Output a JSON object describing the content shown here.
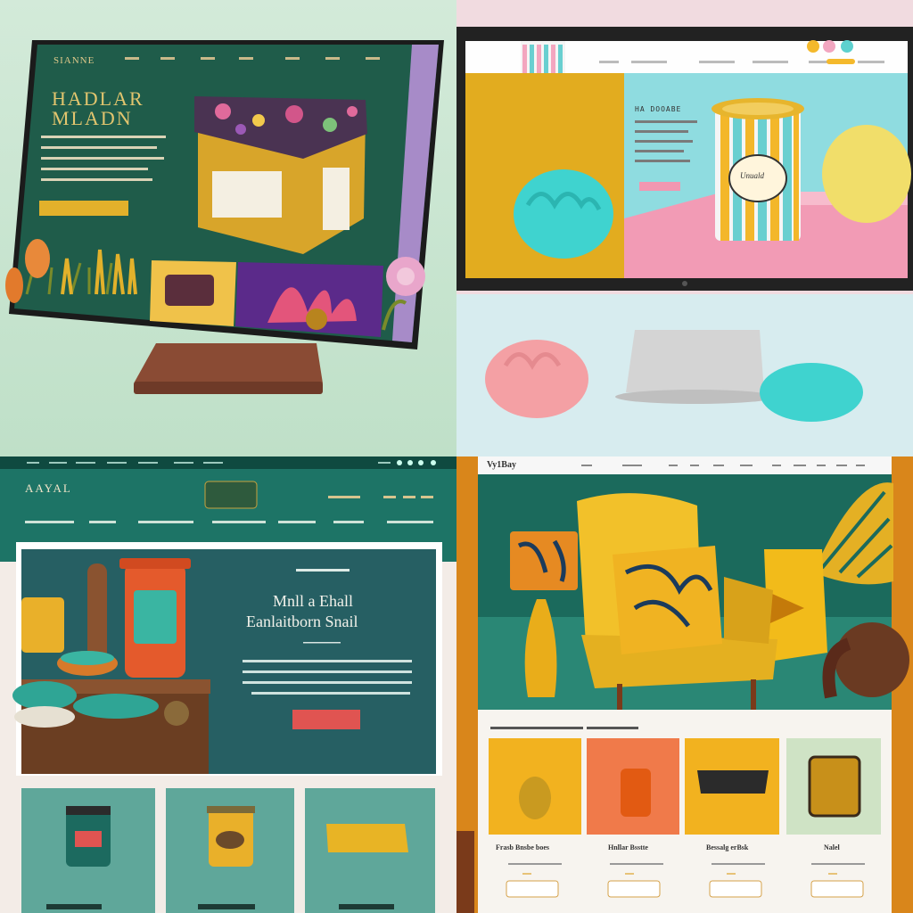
{
  "colors": {
    "mint_bg": "#cfe6d6",
    "forest": "#1f5a49",
    "mustard": "#e2b12b",
    "pink": "#f1b3c2",
    "teal": "#1d7466",
    "violet": "#6a3fa0",
    "turquoise": "#36d0cc",
    "coral": "#e46156"
  },
  "q1": {
    "brand": "SIANNE",
    "nav": [
      "",
      ""
    ],
    "headline_line1": "HADLAR",
    "headline_line2": "MLADN"
  },
  "q2": {
    "heading": "HA DOOABE",
    "cup_label": "Unuald"
  },
  "q3": {
    "brand": "AAYAL",
    "hero_line1": "Mnll a Ehall",
    "hero_line2": "Eanlaitborn Snail"
  },
  "q4": {
    "brand": "Vy1Bay",
    "products": [
      {
        "name": "Frasb Bnsbe boes"
      },
      {
        "name": "Hnllar  Bsstte"
      },
      {
        "name": "Bessalg erBsk"
      },
      {
        "name": "Nalel"
      }
    ]
  },
  "icons": [
    "monitor-icon",
    "lamp-icon",
    "chair-icon",
    "leaf-icon",
    "vase-icon",
    "cup-icon"
  ]
}
